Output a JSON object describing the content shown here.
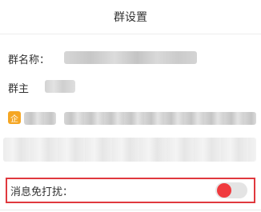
{
  "header": {
    "title": "群设置"
  },
  "group": {
    "name_label": "群名称：",
    "owner_label": "群主",
    "enterprise_badge": "企"
  },
  "settings": {
    "dnd_label": "消息免打扰：",
    "dnd_enabled": false,
    "toggle_knob_color": "#f03a3e"
  }
}
